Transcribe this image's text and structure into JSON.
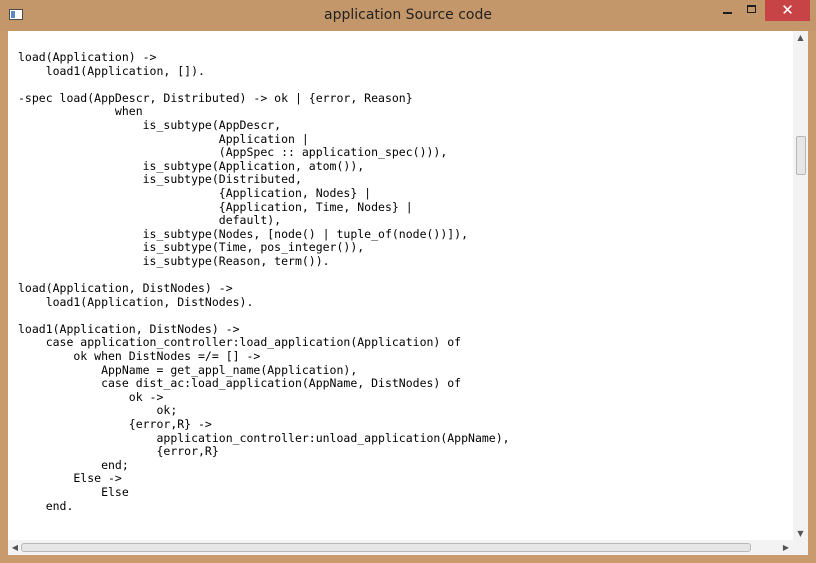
{
  "window": {
    "title": "application Source code",
    "close_glyph": "✕"
  },
  "icons": {
    "app": "window-icon",
    "minimize": "minimize-icon",
    "maximize": "maximize-icon",
    "close": "close-icon",
    "scroll_up": "▲",
    "scroll_down": "▼",
    "scroll_left": "◀",
    "scroll_right": "▶"
  },
  "colors": {
    "frame": "#c89a6c",
    "close_button": "#c74346",
    "editor_background": "#ffffff"
  },
  "editor": {
    "lines": [
      "load(Application) ->",
      "    load1(Application, []).",
      "",
      "-spec load(AppDescr, Distributed) -> ok | {error, Reason}",
      "              when",
      "                  is_subtype(AppDescr,",
      "                             Application |",
      "                             (AppSpec :: application_spec())),",
      "                  is_subtype(Application, atom()),",
      "                  is_subtype(Distributed,",
      "                             {Application, Nodes} |",
      "                             {Application, Time, Nodes} |",
      "                             default),",
      "                  is_subtype(Nodes, [node() | tuple_of(node())]),",
      "                  is_subtype(Time, pos_integer()),",
      "                  is_subtype(Reason, term()).",
      "",
      "load(Application, DistNodes) ->",
      "    load1(Application, DistNodes).",
      "",
      "load1(Application, DistNodes) ->",
      "    case application_controller:load_application(Application) of",
      "        ok when DistNodes =/= [] ->",
      "            AppName = get_appl_name(Application),",
      "            case dist_ac:load_application(AppName, DistNodes) of",
      "                ok ->",
      "                    ok;",
      "                {error,R} ->",
      "                    application_controller:unload_application(AppName),",
      "                    {error,R}",
      "            end;",
      "        Else ->",
      "            Else",
      "    end."
    ]
  }
}
